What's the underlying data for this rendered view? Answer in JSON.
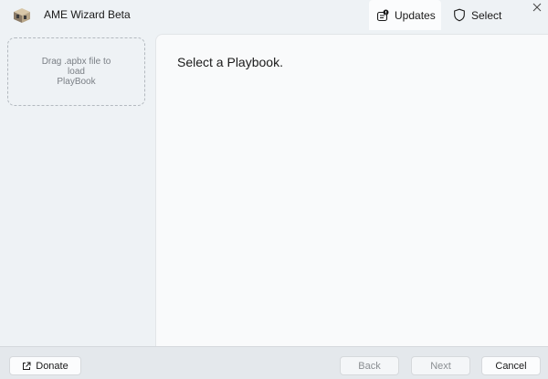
{
  "window": {
    "title": "AME Wizard Beta"
  },
  "nav": {
    "updates_label": "Updates",
    "select_label": "Select"
  },
  "sidebar": {
    "dropzone_line1": "Drag .apbx file to",
    "dropzone_line2": "load",
    "dropzone_line3": "PlayBook"
  },
  "main": {
    "heading": "Select a Playbook."
  },
  "footer": {
    "donate_label": "Donate",
    "back_label": "Back",
    "next_label": "Next",
    "cancel_label": "Cancel"
  },
  "colors": {
    "window_bg": "#eef2f5",
    "content_bg": "#f9fafb",
    "footer_bg": "#e4e8ec"
  }
}
